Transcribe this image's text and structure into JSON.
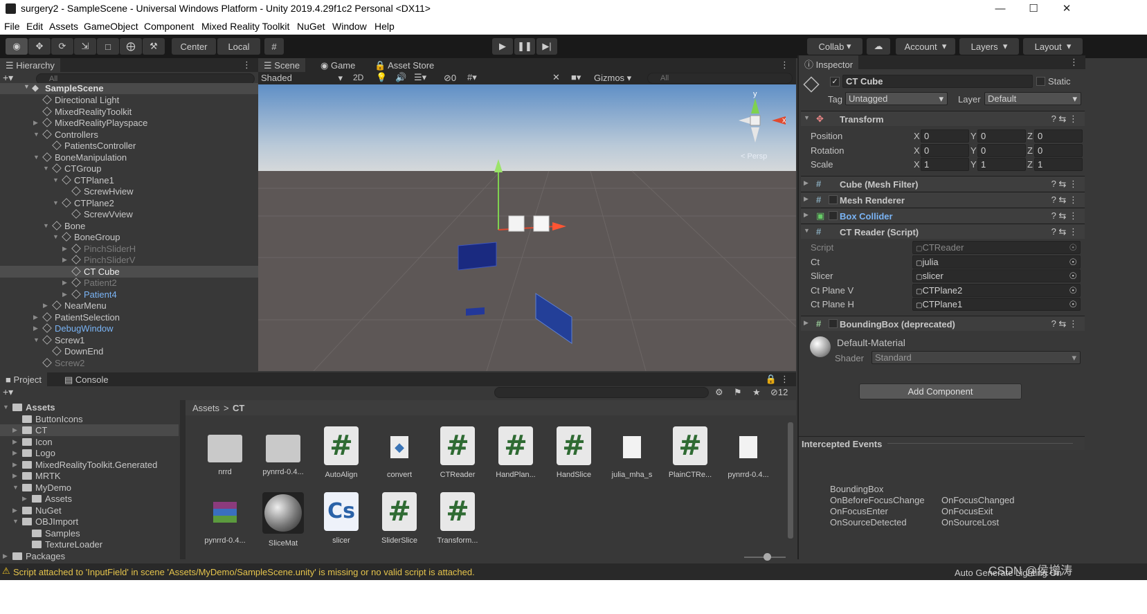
{
  "window": {
    "title": "surgery2 - SampleScene - Universal Windows Platform - Unity 2019.4.29f1c2 Personal <DX11>"
  },
  "menu": [
    "File",
    "Edit",
    "Assets",
    "GameObject",
    "Component",
    "Mixed Reality Toolkit",
    "NuGet",
    "Window",
    "Help"
  ],
  "toolbar": {
    "center": "Center",
    "local": "Local",
    "collab": "Collab",
    "account": "Account",
    "layers": "Layers",
    "layout": "Layout"
  },
  "hierarchy": {
    "tab": "Hierarchy",
    "search_placeholder": "All",
    "scene": "SampleScene",
    "items": [
      {
        "label": "Directional Light",
        "depth": 1,
        "arrow": ""
      },
      {
        "label": "MixedRealityToolkit",
        "depth": 1,
        "arrow": ""
      },
      {
        "label": "MixedRealityPlayspace",
        "depth": 1,
        "arrow": "▶"
      },
      {
        "label": "Controllers",
        "depth": 1,
        "arrow": "▼"
      },
      {
        "label": "PatientsController",
        "depth": 2,
        "arrow": ""
      },
      {
        "label": "BoneManipulation",
        "depth": 1,
        "arrow": "▼"
      },
      {
        "label": "CTGroup",
        "depth": 2,
        "arrow": "▼"
      },
      {
        "label": "CTPlane1",
        "depth": 3,
        "arrow": "▼"
      },
      {
        "label": "ScrewHview",
        "depth": 4,
        "arrow": ""
      },
      {
        "label": "CTPlane2",
        "depth": 3,
        "arrow": "▼"
      },
      {
        "label": "ScrewVview",
        "depth": 4,
        "arrow": ""
      },
      {
        "label": "Bone",
        "depth": 2,
        "arrow": "▼"
      },
      {
        "label": "BoneGroup",
        "depth": 3,
        "arrow": "▼"
      },
      {
        "label": "PinchSliderH",
        "depth": 4,
        "arrow": "▶",
        "style": "dim"
      },
      {
        "label": "PinchSliderV",
        "depth": 4,
        "arrow": "▶",
        "style": "dim"
      },
      {
        "label": "CT Cube",
        "depth": 4,
        "arrow": "",
        "style": "selected"
      },
      {
        "label": "Patient2",
        "depth": 4,
        "arrow": "▶",
        "style": "dim"
      },
      {
        "label": "Patient4",
        "depth": 4,
        "arrow": "▶",
        "style": "prefab"
      },
      {
        "label": "NearMenu",
        "depth": 2,
        "arrow": "▶"
      },
      {
        "label": "PatientSelection",
        "depth": 1,
        "arrow": "▶"
      },
      {
        "label": "DebugWindow",
        "depth": 1,
        "arrow": "▶",
        "style": "prefab"
      },
      {
        "label": "Screw1",
        "depth": 1,
        "arrow": "▼"
      },
      {
        "label": "DownEnd",
        "depth": 2,
        "arrow": ""
      },
      {
        "label": "Screw2",
        "depth": 1,
        "arrow": "",
        "style": "dim"
      }
    ]
  },
  "scene": {
    "tabs": [
      "Scene",
      "Game",
      "Asset Store"
    ],
    "shading": "Shaded",
    "mode_2d": "2D",
    "hidden_count": "0",
    "gizmos": "Gizmos",
    "search_placeholder": "All",
    "axis_y": "y",
    "axis_x": "x",
    "persp": "< Persp"
  },
  "inspector": {
    "tab": "Inspector",
    "object_name": "CT Cube",
    "static": "Static",
    "tag_label": "Tag",
    "tag": "Untagged",
    "layer_label": "Layer",
    "layer": "Default",
    "transform": {
      "title": "Transform",
      "rows": [
        {
          "label": "Position",
          "x": "0",
          "y": "0",
          "z": "0"
        },
        {
          "label": "Rotation",
          "x": "0",
          "y": "0",
          "z": "0"
        },
        {
          "label": "Scale",
          "x": "1",
          "y": "1",
          "z": "1"
        }
      ]
    },
    "components": [
      "Cube (Mesh Filter)",
      "Mesh Renderer",
      "Box Collider",
      "CT Reader (Script)"
    ],
    "script_fields": [
      {
        "label": "Script",
        "value": "CTReader"
      },
      {
        "label": "Ct",
        "value": "julia"
      },
      {
        "label": "Slicer",
        "value": "slicer"
      },
      {
        "label": "Ct Plane V",
        "value": "CTPlane2"
      },
      {
        "label": "Ct Plane H",
        "value": "CTPlane1"
      }
    ],
    "bounding_box": "BoundingBox (deprecated)",
    "material": "Default-Material",
    "shader_label": "Shader",
    "shader": "Standard",
    "add_component": "Add Component",
    "intercepted_title": "Intercepted Events",
    "events_header": "BoundingBox",
    "events_left": [
      "OnBeforeFocusChange",
      "OnFocusEnter",
      "OnSourceDetected"
    ],
    "events_right": [
      "OnFocusChanged",
      "OnFocusExit",
      "OnSourceLost"
    ]
  },
  "project": {
    "tabs": [
      "Project",
      "Console"
    ],
    "hidden_count": "12",
    "tree": [
      {
        "label": "Assets",
        "depth": 0,
        "arrow": "▼",
        "bold": true
      },
      {
        "label": "ButtonIcons",
        "depth": 1,
        "arrow": ""
      },
      {
        "label": "CT",
        "depth": 1,
        "arrow": "▶",
        "selected": true
      },
      {
        "label": "Icon",
        "depth": 1,
        "arrow": "▶"
      },
      {
        "label": "Logo",
        "depth": 1,
        "arrow": "▶"
      },
      {
        "label": "MixedRealityToolkit.Generated",
        "depth": 1,
        "arrow": "▶"
      },
      {
        "label": "MRTK",
        "depth": 1,
        "arrow": "▶"
      },
      {
        "label": "MyDemo",
        "depth": 1,
        "arrow": "▼"
      },
      {
        "label": "Assets",
        "depth": 2,
        "arrow": "▶"
      },
      {
        "label": "NuGet",
        "depth": 1,
        "arrow": "▶"
      },
      {
        "label": "OBJImport",
        "depth": 1,
        "arrow": "▼"
      },
      {
        "label": "Samples",
        "depth": 2,
        "arrow": ""
      },
      {
        "label": "TextureLoader",
        "depth": 2,
        "arrow": ""
      },
      {
        "label": "Packages",
        "depth": 0,
        "arrow": "▶"
      }
    ],
    "breadcrumb": [
      "Assets",
      "CT"
    ],
    "assets": [
      {
        "label": "nrrd",
        "kind": "folder"
      },
      {
        "label": "pynrrd-0.4...",
        "kind": "folder"
      },
      {
        "label": "AutoAlign",
        "kind": "script"
      },
      {
        "label": "convert",
        "kind": "python"
      },
      {
        "label": "CTReader",
        "kind": "script"
      },
      {
        "label": "HandPlan...",
        "kind": "script"
      },
      {
        "label": "HandSlice",
        "kind": "script"
      },
      {
        "label": "julia_mha_s",
        "kind": "file"
      },
      {
        "label": "PlainCTRe...",
        "kind": "script"
      },
      {
        "label": "pynrrd-0.4...",
        "kind": "file"
      },
      {
        "label": "pynrrd-0.4...",
        "kind": "archive"
      },
      {
        "label": "SliceMat",
        "kind": "material"
      },
      {
        "label": "slicer",
        "kind": "cs"
      },
      {
        "label": "SliderSlice",
        "kind": "script"
      },
      {
        "label": "Transform...",
        "kind": "script"
      }
    ]
  },
  "status": {
    "message": "Script attached to 'InputField' in scene 'Assets/MyDemo/SampleScene.unity' is missing or no valid script is attached.",
    "right": "Auto Generate Lighting On",
    "watermark": "CSDN @侯增涛"
  }
}
